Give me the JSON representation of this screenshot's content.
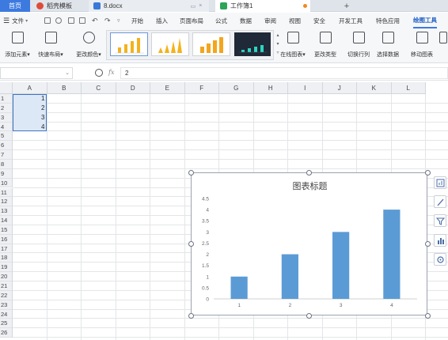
{
  "tabs": {
    "home": "首页",
    "template": "稻壳模板",
    "doc": "8.docx",
    "book": "工作簿1",
    "add": "+"
  },
  "menu": {
    "file": "文件",
    "items": [
      "开始",
      "插入",
      "页面布局",
      "公式",
      "数据",
      "审阅",
      "视图",
      "安全",
      "开发工具",
      "特色应用",
      "绘图工具"
    ]
  },
  "ribbon": {
    "add_element": "添加元素",
    "quick_layout": "快速布局",
    "change_color": "更改颜色",
    "online_chart": "在线图表",
    "change_type": "更改类型",
    "switch_rowcol": "切换行列",
    "select_data": "选择数据",
    "move_chart": "移动图表"
  },
  "formula": {
    "fx": "fx",
    "value": "2"
  },
  "columns": [
    "A",
    "B",
    "C",
    "D",
    "E",
    "F",
    "G",
    "H",
    "I",
    "J",
    "K",
    "L"
  ],
  "rows": [
    "1",
    "2",
    "3",
    "4",
    "5",
    "6",
    "7",
    "8",
    "9",
    "10",
    "11",
    "12",
    "13",
    "14",
    "15",
    "16",
    "17",
    "18",
    "19",
    "20",
    "21",
    "22",
    "23",
    "24",
    "25",
    "26"
  ],
  "cells": {
    "A1": "1",
    "A2": "2",
    "A3": "3",
    "A4": "4"
  },
  "colors": {
    "bar": "#5b9bd5",
    "selection": "#dde8f7",
    "tab_active": "#3c7ae0"
  },
  "chart_data": {
    "type": "bar",
    "title": "图表标题",
    "categories": [
      "1",
      "2",
      "3",
      "4"
    ],
    "series": [
      {
        "values": [
          1,
          2,
          3,
          4
        ]
      }
    ],
    "ylim": [
      0,
      4.5
    ],
    "yticks": [
      "0",
      "0.5",
      "1",
      "1.5",
      "2",
      "2.5",
      "3",
      "3.5",
      "4",
      "4.5"
    ],
    "grid": false,
    "legend": "none"
  }
}
